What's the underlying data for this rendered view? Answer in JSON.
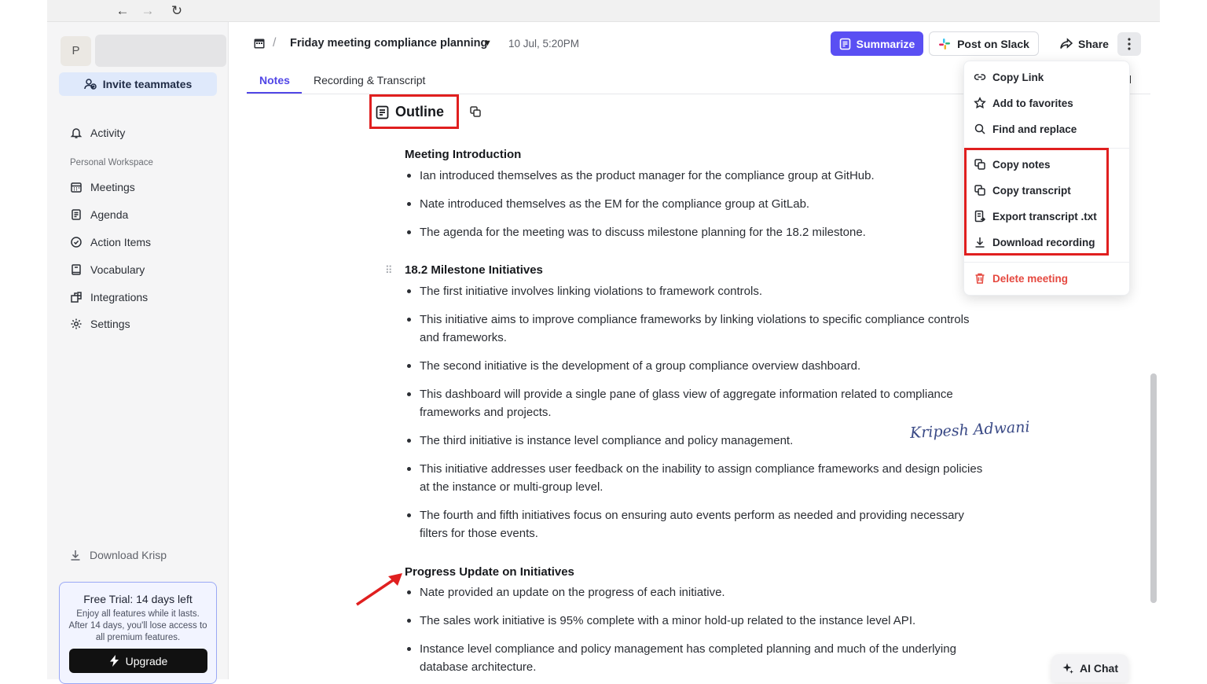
{
  "browser": {
    "back": "←",
    "forward": "→",
    "reload": "↻"
  },
  "sidebar": {
    "avatar_letter": "P",
    "invite_label": "Invite teammates",
    "activity": "Activity",
    "section": "Personal Workspace",
    "items": [
      {
        "label": "Meetings",
        "icon": "calendar-icon"
      },
      {
        "label": "Agenda",
        "icon": "document-icon"
      },
      {
        "label": "Action Items",
        "icon": "check-circle-icon"
      },
      {
        "label": "Vocabulary",
        "icon": "book-icon"
      },
      {
        "label": "Integrations",
        "icon": "puzzle-icon"
      },
      {
        "label": "Settings",
        "icon": "gear-icon"
      }
    ],
    "download": "Download Krisp",
    "trial": {
      "title": "Free Trial: 14 days left",
      "description": "Enjoy all features while it lasts. After 14 days, you'll lose access to all premium features.",
      "upgrade_label": "Upgrade"
    }
  },
  "header": {
    "separator": "/",
    "meeting_title": "Friday meeting compliance planning",
    "date": "10 Jul, 5:20PM",
    "summarize_label": "Summarize",
    "slack_label": "Post on Slack",
    "share_label": "Share"
  },
  "tabs": [
    {
      "label": "Notes",
      "active": true
    },
    {
      "label": "Recording & Transcript",
      "active": false
    }
  ],
  "outline": {
    "title": "Outline"
  },
  "sections": [
    {
      "title": "Meeting Introduction",
      "bullets": [
        "Ian introduced themselves as the product manager for the compliance group at GitHub.",
        "Nate introduced themselves as the EM for the compliance group at GitLab.",
        "The agenda for the meeting was to discuss milestone planning for the 18.2 milestone."
      ]
    },
    {
      "title": "18.2 Milestone Initiatives",
      "bullets": [
        "The first initiative involves linking violations to framework controls.",
        "This initiative aims to improve compliance frameworks by linking violations to specific compliance controls and frameworks.",
        "The second initiative is the development of a group compliance overview dashboard.",
        "This dashboard will provide a single pane of glass view of aggregate information related to compliance frameworks and projects.",
        "The third initiative is instance level compliance and policy management.",
        "This initiative addresses user feedback on the inability to assign compliance frameworks and design policies at the instance or multi-group level.",
        "The fourth and fifth initiatives focus on ensuring auto events perform as needed and providing necessary filters for those events."
      ]
    },
    {
      "title": "Progress Update on Initiatives",
      "bullets": [
        "Nate provided an update on the progress of each initiative.",
        "The sales work initiative is 95% complete with a minor hold-up related to the instance level API.",
        "Instance level compliance and policy management has completed planning and much of the underlying database architecture."
      ]
    }
  ],
  "menu": {
    "items": [
      {
        "label": "Copy Link",
        "icon": "link-icon"
      },
      {
        "label": "Add to favorites",
        "icon": "star-icon"
      },
      {
        "label": "Find and replace",
        "icon": "search-icon"
      },
      {
        "label": "Copy notes",
        "icon": "copy-icon"
      },
      {
        "label": "Copy transcript",
        "icon": "copy-icon"
      },
      {
        "label": "Export transcript .txt",
        "icon": "export-file-icon"
      },
      {
        "label": "Download recording",
        "icon": "download-icon"
      }
    ],
    "delete_label": "Delete meeting"
  },
  "signature": "Kripesh Adwani",
  "ai_chat_label": "AI Chat",
  "colors": {
    "accent": "#5a4ff3",
    "highlight": "#e01f1f",
    "danger": "#e5483f"
  }
}
